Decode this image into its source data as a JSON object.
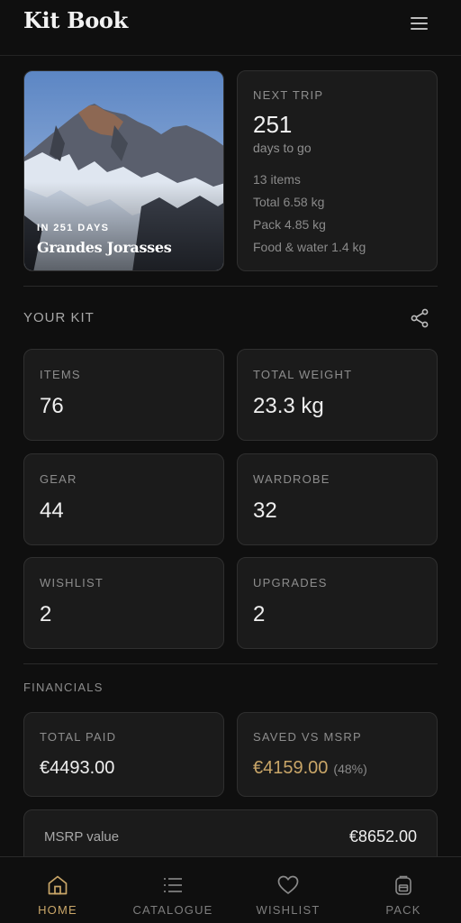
{
  "app": {
    "title": "Kit Book"
  },
  "hero": {
    "days_label": "IN 251 DAYS",
    "destination": "Grandes Jorasses"
  },
  "next_trip": {
    "label": "NEXT TRIP",
    "days": "251",
    "days_sub": "days to go",
    "stats": [
      "13 items",
      "Total 6.58 kg",
      "Pack 4.85 kg",
      "Food & water 1.4 kg"
    ]
  },
  "your_kit": {
    "title": "YOUR KIT",
    "stats": [
      {
        "label": "ITEMS",
        "value": "76"
      },
      {
        "label": "TOTAL WEIGHT",
        "value": "23.3 kg"
      },
      {
        "label": "GEAR",
        "value": "44"
      },
      {
        "label": "WARDROBE",
        "value": "32"
      },
      {
        "label": "WISHLIST",
        "value": "2"
      },
      {
        "label": "UPGRADES",
        "value": "2"
      }
    ]
  },
  "financials": {
    "title": "FINANCIALS",
    "total_paid_label": "TOTAL PAID",
    "total_paid": "€4493.00",
    "saved_label": "SAVED VS MSRP",
    "saved": "€4159.00",
    "saved_pct": "(48%)",
    "msrp_label": "MSRP value",
    "msrp_value": "€8652.00"
  },
  "nav": {
    "items": [
      {
        "label": "HOME",
        "icon": "home-icon",
        "active": true
      },
      {
        "label": "CATALOGUE",
        "icon": "list-icon",
        "active": false
      },
      {
        "label": "WISHLIST",
        "icon": "heart-icon",
        "active": false
      },
      {
        "label": "PACK",
        "icon": "backpack-icon",
        "active": false
      }
    ]
  },
  "colors": {
    "accent": "#c9a668",
    "background": "#0f0f0f",
    "card": "#1b1b1b"
  }
}
